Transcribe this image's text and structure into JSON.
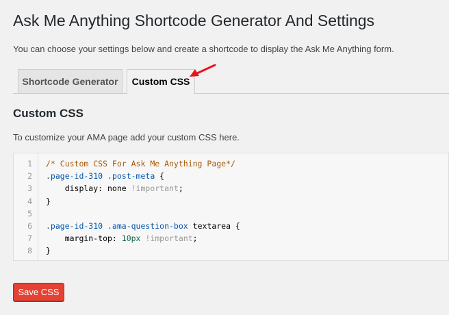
{
  "header": {
    "title": "Ask Me Anything Shortcode Generator And Settings",
    "intro": "You can choose your settings below and create a shortcode to display the Ask Me Anything form."
  },
  "tabs": [
    {
      "label": "Shortcode Generator",
      "active": false
    },
    {
      "label": "Custom CSS",
      "active": true
    }
  ],
  "section": {
    "title": "Custom CSS",
    "help": "To customize your AMA page add your custom CSS here."
  },
  "editor": {
    "lines": [
      {
        "n": "1",
        "tokens": [
          {
            "t": "comment",
            "v": "/* Custom CSS For Ask Me Anything Page*/"
          }
        ]
      },
      {
        "n": "2",
        "tokens": [
          {
            "t": "sel",
            "v": ".page-id-310 .post-meta"
          },
          {
            "t": "punc",
            "v": " {"
          }
        ]
      },
      {
        "n": "3",
        "tokens": [
          {
            "t": "prop",
            "v": "    display: none "
          },
          {
            "t": "imp",
            "v": "!important"
          },
          {
            "t": "punc",
            "v": ";"
          }
        ]
      },
      {
        "n": "4",
        "tokens": [
          {
            "t": "punc",
            "v": "}"
          }
        ]
      },
      {
        "n": "5",
        "tokens": []
      },
      {
        "n": "6",
        "tokens": [
          {
            "t": "sel",
            "v": ".page-id-310 .ama-question-box"
          },
          {
            "t": "prop",
            "v": " textarea"
          },
          {
            "t": "punc",
            "v": " {"
          }
        ]
      },
      {
        "n": "7",
        "tokens": [
          {
            "t": "prop",
            "v": "    margin-top: "
          },
          {
            "t": "num",
            "v": "10px"
          },
          {
            "t": "imp",
            "v": " !important"
          },
          {
            "t": "punc",
            "v": ";"
          }
        ]
      },
      {
        "n": "8",
        "tokens": [
          {
            "t": "punc",
            "v": "}"
          }
        ]
      }
    ]
  },
  "actions": {
    "save_label": "Save CSS"
  },
  "colors": {
    "save_button": "#e34234",
    "annotation_arrow": "#e8141b"
  },
  "icons": {
    "annotation": "red-arrow-icon"
  }
}
